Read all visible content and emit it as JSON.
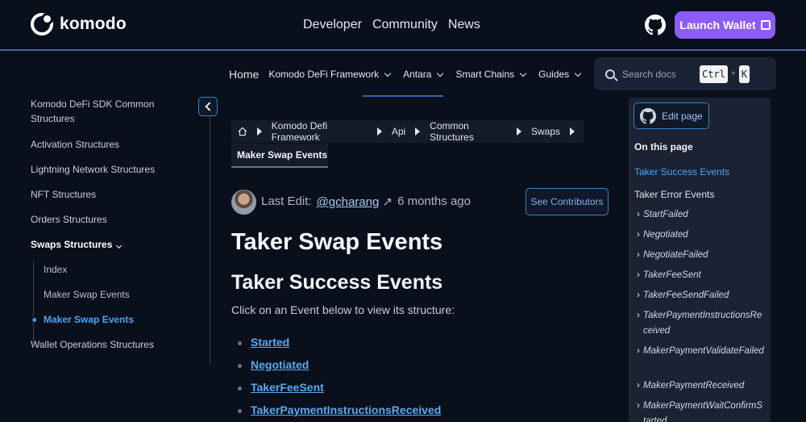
{
  "header": {
    "brand": "komodo",
    "nav": [
      "Developer",
      "Community",
      "News"
    ],
    "launch_label": "Launch Wallet"
  },
  "subnav": {
    "home": "Home",
    "items": [
      "Komodo DeFi Framework",
      "Antara",
      "Smart Chains",
      "Guides"
    ]
  },
  "search": {
    "placeholder": "Search docs",
    "key1": "Ctrl",
    "plus": "+",
    "key2": "K"
  },
  "sidebar": {
    "items": [
      "Komodo DeFi SDK Common Structures",
      "Activation Structures",
      "Lightning Network Structures",
      "NFT Structures",
      "Orders Structures",
      "Swaps Structures",
      "Index",
      "Maker Swap Events",
      "Maker Swap Events",
      "Wallet Operations Structures"
    ]
  },
  "breadcrumbs": {
    "items": [
      "Komodo Defi Framework",
      "Api",
      "Common Structures",
      "Swaps"
    ],
    "current": "Maker Swap Events"
  },
  "edit_info": {
    "label": "Last Edit:",
    "user": "@gcharang",
    "arrow": "↗",
    "time": "6 months ago",
    "contributors_label": "See Contributors"
  },
  "content": {
    "title": "Taker Swap Events",
    "section": "Taker Success Events",
    "intro": "Click on an Event below to view its structure:",
    "events": [
      "Started",
      "Negotiated",
      "TakerFeeSent",
      "TakerPaymentInstructionsReceived"
    ]
  },
  "toc": {
    "edit_label": "Edit page",
    "title": "On this page",
    "items": [
      "Taker Success Events",
      "Taker Error Events",
      "StartFailed",
      "Negotiated",
      "NegotiateFailed",
      "TakerFeeSent",
      "TakerFeeSendFailed",
      "TakerPaymentInstructionsReceived",
      "MakerPaymentValidateFailed",
      "MakerPaymentReceived",
      "MakerPaymentWaitConfirmStarted"
    ]
  },
  "colors": {
    "accent": "#8b5cf6",
    "link": "#4aa3f0",
    "background": "#0a0f1c"
  }
}
